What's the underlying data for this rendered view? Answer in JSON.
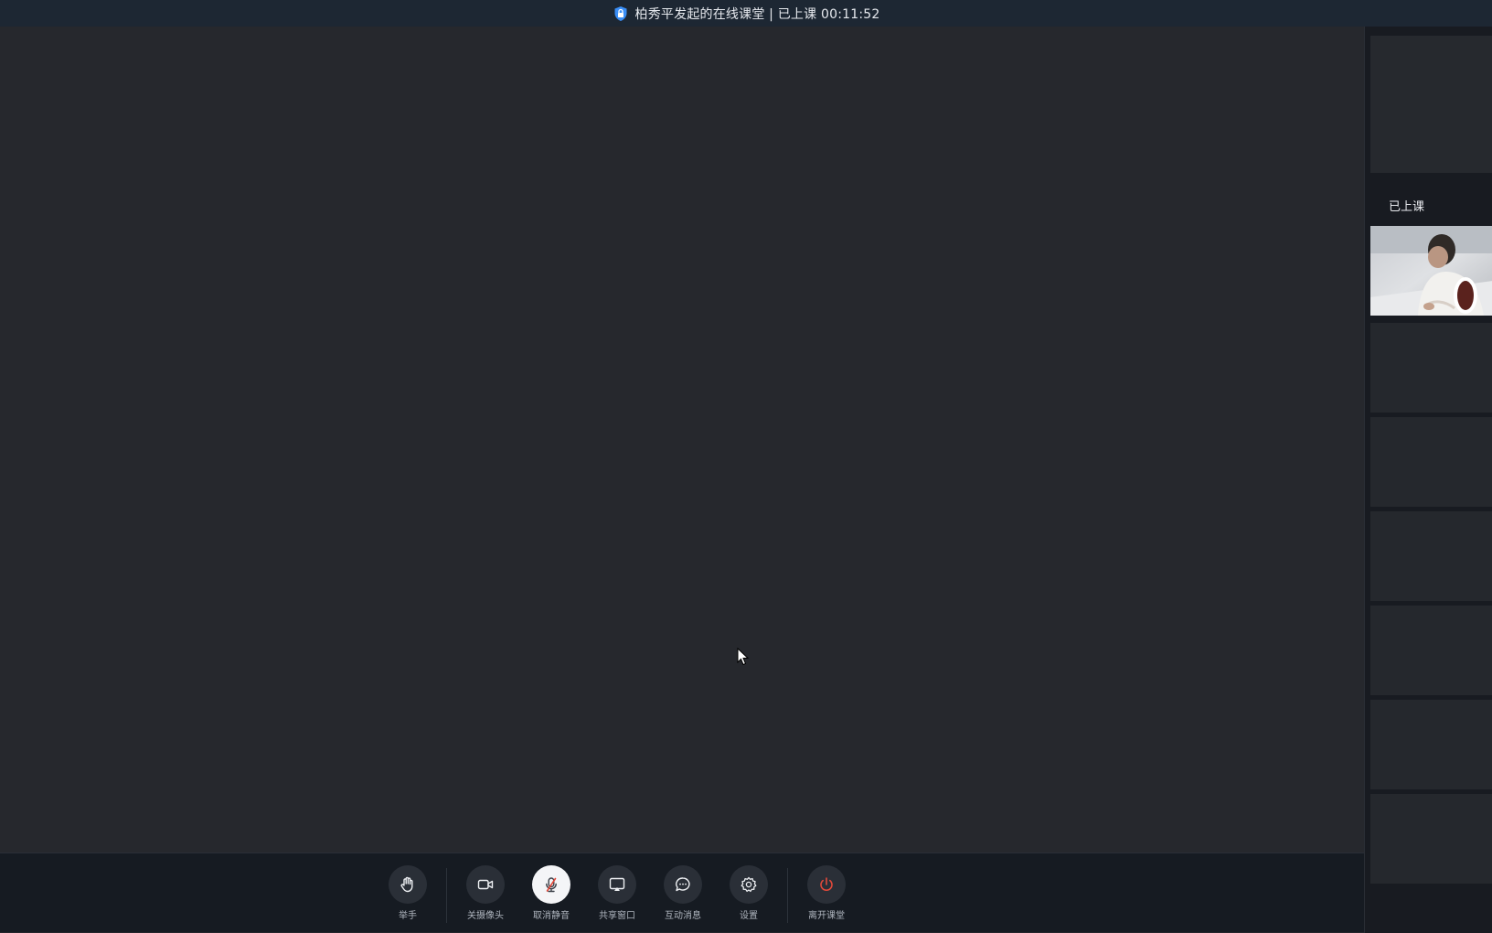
{
  "window": {
    "title": "柏秀平发起的在线课堂 | 已上课 00:11:52",
    "lock_icon": "shield-lock-icon"
  },
  "toolbar": {
    "buttons": [
      {
        "label": "举手",
        "icon": "raise-hand-icon"
      },
      {
        "label": "关摄像头",
        "icon": "camera-icon"
      },
      {
        "label": "取消静音",
        "icon": "mic-muted-icon"
      },
      {
        "label": "共享窗口",
        "icon": "screen-share-icon"
      },
      {
        "label": "互动消息",
        "icon": "chat-bubble-icon"
      },
      {
        "label": "设置",
        "icon": "gear-icon"
      },
      {
        "label": "离开课堂",
        "icon": "power-icon"
      }
    ]
  },
  "sidebar": {
    "section_label": "已上课"
  },
  "colors": {
    "accent": "#3a8ef6",
    "danger": "#e2493a",
    "stage": "#26282d"
  }
}
